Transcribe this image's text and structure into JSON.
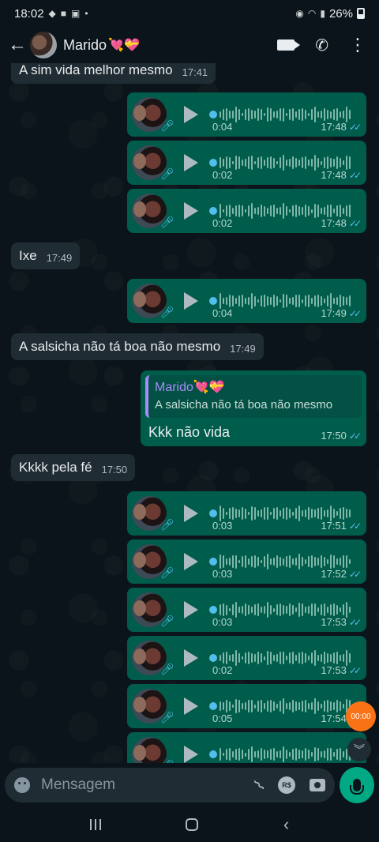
{
  "status_bar": {
    "time": "18:02",
    "battery": "26%"
  },
  "header": {
    "contact_name": "Marido",
    "contact_emoji": "💘💝"
  },
  "messages": [
    {
      "type": "text",
      "dir": "in",
      "text": "A sim vida melhor mesmo",
      "time": "17:41"
    },
    {
      "type": "voice",
      "dir": "out",
      "duration": "0:04",
      "time": "17:48"
    },
    {
      "type": "voice",
      "dir": "out",
      "duration": "0:02",
      "time": "17:48"
    },
    {
      "type": "voice",
      "dir": "out",
      "duration": "0:02",
      "time": "17:48"
    },
    {
      "type": "text",
      "dir": "in",
      "text": "Ixe",
      "time": "17:49"
    },
    {
      "type": "voice",
      "dir": "out",
      "duration": "0:04",
      "time": "17:49"
    },
    {
      "type": "text",
      "dir": "in",
      "text": "A salsicha não tá boa não mesmo",
      "time": "17:49"
    },
    {
      "type": "reply",
      "dir": "out",
      "quoted_name": "Marido💘💝",
      "quoted_text": "A salsicha não tá boa não mesmo",
      "text": "Kkk não vida",
      "time": "17:50"
    },
    {
      "type": "text",
      "dir": "in",
      "text": "Kkkk pela fé",
      "time": "17:50"
    },
    {
      "type": "voice",
      "dir": "out",
      "duration": "0:03",
      "time": "17:51"
    },
    {
      "type": "voice",
      "dir": "out",
      "duration": "0:03",
      "time": "17:52"
    },
    {
      "type": "voice",
      "dir": "out",
      "duration": "0:03",
      "time": "17:53"
    },
    {
      "type": "voice",
      "dir": "out",
      "duration": "0:02",
      "time": "17:53"
    },
    {
      "type": "voice",
      "dir": "out",
      "duration": "0:05",
      "time": "17:54"
    },
    {
      "type": "voice",
      "dir": "out",
      "duration": "",
      "time": ""
    }
  ],
  "floating_timer": "00:00",
  "composer": {
    "placeholder": "Mensagem",
    "currency_icon_label": "R$"
  },
  "colors": {
    "outgoing_bubble": "#005c4b",
    "incoming_bubble": "#202c33",
    "accent": "#00a884",
    "read_ticks": "#53bdeb"
  }
}
